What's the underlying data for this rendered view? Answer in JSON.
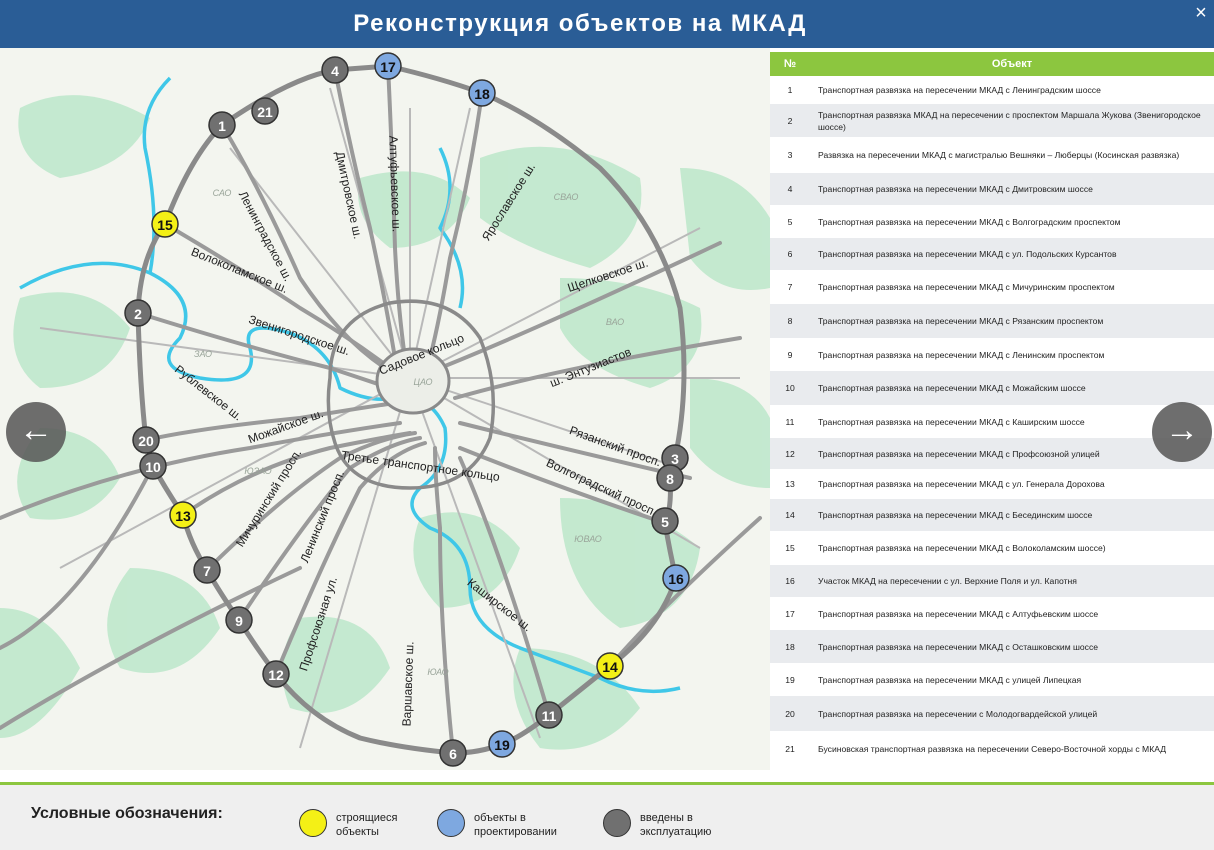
{
  "header": {
    "title": "Реконструкция объектов на МКАД",
    "close_label": "×"
  },
  "nav": {
    "prev_label": "←",
    "next_label": "→"
  },
  "colors": {
    "header_bg": "#2a5d96",
    "table_header_bg": "#8cc63f",
    "status_construction": "#f4f016",
    "status_design": "#7ea8e0",
    "status_operational": "#707070"
  },
  "map": {
    "roads": [
      {
        "id": "leningradskoe",
        "label": "Ленинградское ш."
      },
      {
        "id": "dmitrovskoe",
        "label": "Дмитровское ш."
      },
      {
        "id": "altufyevskoe",
        "label": "Алтуфьевское ш."
      },
      {
        "id": "yaroslavskoe",
        "label": "Ярославское ш."
      },
      {
        "id": "volokolamskoe",
        "label": "Волоколамское ш."
      },
      {
        "id": "shchelkovskoe",
        "label": "Щелковское ш."
      },
      {
        "id": "zvenigorodskoe",
        "label": "Звенигородское ш."
      },
      {
        "id": "sadovoe",
        "label": "Садовое кольцо"
      },
      {
        "id": "entuziastov",
        "label": "ш. Энтузиастов"
      },
      {
        "id": "rublevskoe",
        "label": "Рублевское ш."
      },
      {
        "id": "mozhayskoe",
        "label": "Можайское ш."
      },
      {
        "id": "ryazansky",
        "label": "Рязанский просп."
      },
      {
        "id": "ttk",
        "label": "Третье транспортное кольцо"
      },
      {
        "id": "michurinsky",
        "label": "Мичуринский просп."
      },
      {
        "id": "leninsky",
        "label": "Ленинский просп."
      },
      {
        "id": "volgogradsky",
        "label": "Волгоградский просп."
      },
      {
        "id": "profsoyuznaya",
        "label": "Профсоюзная ул."
      },
      {
        "id": "kashirskoe",
        "label": "Каширское ш."
      },
      {
        "id": "varshavskoe",
        "label": "Варшавское ш."
      }
    ],
    "districts": [
      {
        "id": "svao",
        "label": "СВАО"
      },
      {
        "id": "sao",
        "label": "САО"
      },
      {
        "id": "vao",
        "label": "ВАО"
      },
      {
        "id": "zao",
        "label": "ЗАО"
      },
      {
        "id": "cao",
        "label": "ЦАО"
      },
      {
        "id": "yuzao",
        "label": "ЮЗАО"
      },
      {
        "id": "yuvao",
        "label": "ЮВАО"
      },
      {
        "id": "yuao",
        "label": "ЮАО"
      }
    ],
    "markers": [
      {
        "num": "1",
        "status": "operational"
      },
      {
        "num": "2",
        "status": "operational"
      },
      {
        "num": "3",
        "status": "operational"
      },
      {
        "num": "4",
        "status": "operational"
      },
      {
        "num": "5",
        "status": "operational"
      },
      {
        "num": "6",
        "status": "operational"
      },
      {
        "num": "7",
        "status": "operational"
      },
      {
        "num": "8",
        "status": "operational"
      },
      {
        "num": "9",
        "status": "operational"
      },
      {
        "num": "10",
        "status": "operational"
      },
      {
        "num": "11",
        "status": "operational"
      },
      {
        "num": "12",
        "status": "operational"
      },
      {
        "num": "13",
        "status": "construction"
      },
      {
        "num": "14",
        "status": "construction"
      },
      {
        "num": "15",
        "status": "construction"
      },
      {
        "num": "16",
        "status": "design"
      },
      {
        "num": "17",
        "status": "design"
      },
      {
        "num": "18",
        "status": "design"
      },
      {
        "num": "19",
        "status": "design"
      },
      {
        "num": "20",
        "status": "operational"
      },
      {
        "num": "21",
        "status": "operational"
      }
    ]
  },
  "table": {
    "header_num": "№",
    "header_object": "Объект",
    "rows": [
      {
        "num": "1",
        "text": "Транспортная развязка на пересечении МКАД с Ленинградским шоссе"
      },
      {
        "num": "2",
        "text": "Транспортная развязка МКАД на пересечении с проспектом Маршала Жукова (Звенигородское шоссе)"
      },
      {
        "num": "3",
        "text": "Развязка на пересечении МКАД с магистралью Вешняки – Люберцы (Косинская развязка)"
      },
      {
        "num": "4",
        "text": "Транспортная развязка на пересечении МКАД с Дмитровским шоссе"
      },
      {
        "num": "5",
        "text": "Транспортная развязка на пересечении МКАД с Волгоградским проспектом"
      },
      {
        "num": "6",
        "text": "Транспортная развязка на пересечении МКАД с ул. Подольских Курсантов"
      },
      {
        "num": "7",
        "text": "Транспортная развязка на пересечении МКАД с Мичуринским проспектом"
      },
      {
        "num": "8",
        "text": "Транспортная развязка на пересечении МКАД с Рязанским проспектом"
      },
      {
        "num": "9",
        "text": "Транспортная развязка на пересечении МКАД с Ленинским  проспектом"
      },
      {
        "num": "10",
        "text": "Транспортная развязка на пересечении МКАД с Можайским шоссе"
      },
      {
        "num": "11",
        "text": "Транспортная развязка на пересечении МКАД с Каширским шоссе"
      },
      {
        "num": "12",
        "text": "Транспортная развязка на пересечении МКАД с Профсоюзной улицей"
      },
      {
        "num": "13",
        "text": "Транспортная развязка на пересечении МКАД с ул. Генерала Дорохова"
      },
      {
        "num": "14",
        "text": "Транспортная развязка на пересечении МКАД с Бесединским шоссе"
      },
      {
        "num": "15",
        "text": "Транспортная развязка на пересечении МКАД с Волоколамским шоссе)"
      },
      {
        "num": "16",
        "text": "Участок МКАД на пересечении с ул. Верхние Поля и ул. Капотня"
      },
      {
        "num": "17",
        "text": "Транспортная развязка на пересечении МКАД с Алтуфьевским шоссе"
      },
      {
        "num": "18",
        "text": "Транспортная развязка на пересечении МКАД с Осташковским шоссе"
      },
      {
        "num": "19",
        "text": "Транспортная развязка на пересечении МКАД с улицей Липецкая"
      },
      {
        "num": "20",
        "text": "Транспортная развязка на пересечении с Молодогвардейской улицей"
      },
      {
        "num": "21",
        "text": "Бусиновская транспортная развязка на пересечении Северо-Восточной хорды с МКАД"
      }
    ]
  },
  "legend": {
    "title": "Условные обозначения:",
    "items": [
      {
        "status": "construction",
        "label": "строящиеся\nобъекты"
      },
      {
        "status": "design",
        "label": "объекты в\nпроектировании"
      },
      {
        "status": "operational",
        "label": "введены в\nэксплуатацию"
      }
    ]
  }
}
